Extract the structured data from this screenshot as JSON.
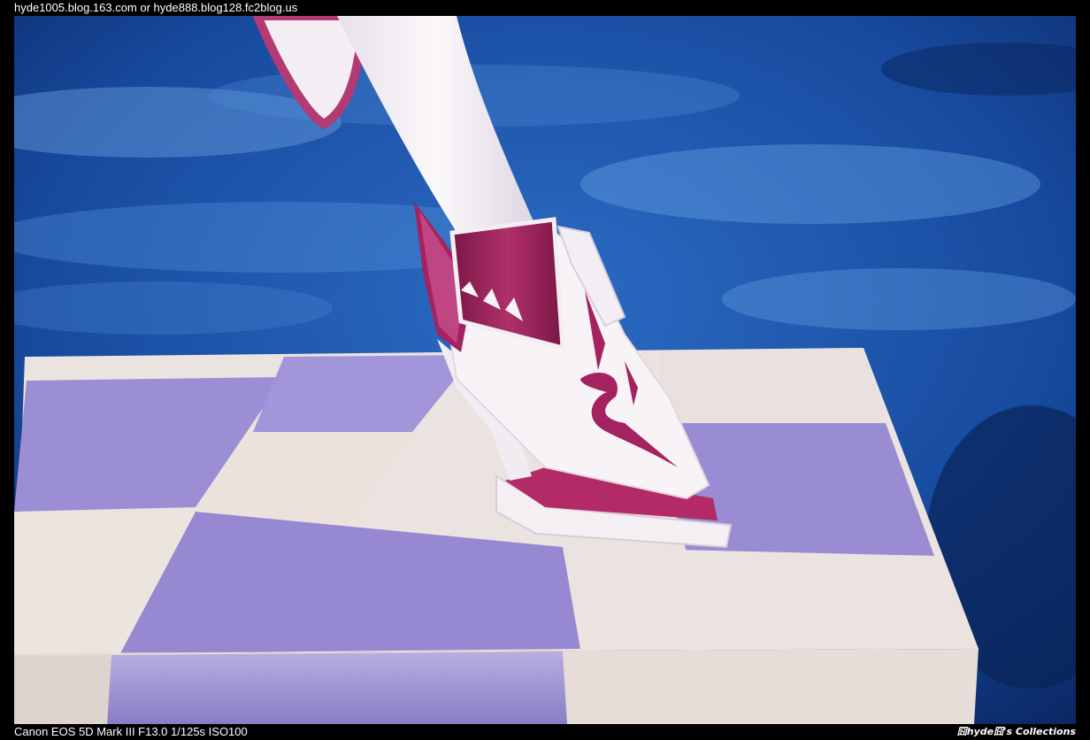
{
  "header": {
    "source_text": "hyde1005.blog.163.com or hyde888.blog128.fc2blog.us"
  },
  "footer": {
    "camera_info": "Canon EOS 5D Mark III F13.0 1/125s ISO100",
    "watermark": "囧hyde囧's Collections"
  },
  "photo": {
    "subject": "figure-shoe-on-checkered-base",
    "colors": {
      "background_blue": "#1b4fa6",
      "background_dark": "#0a2560",
      "checker_lavender": "#9d8fd6",
      "checker_cream": "#ece4e0",
      "shoe_white": "#f5f0f4",
      "shoe_magenta": "#a3225f",
      "frame": "#000000"
    }
  }
}
